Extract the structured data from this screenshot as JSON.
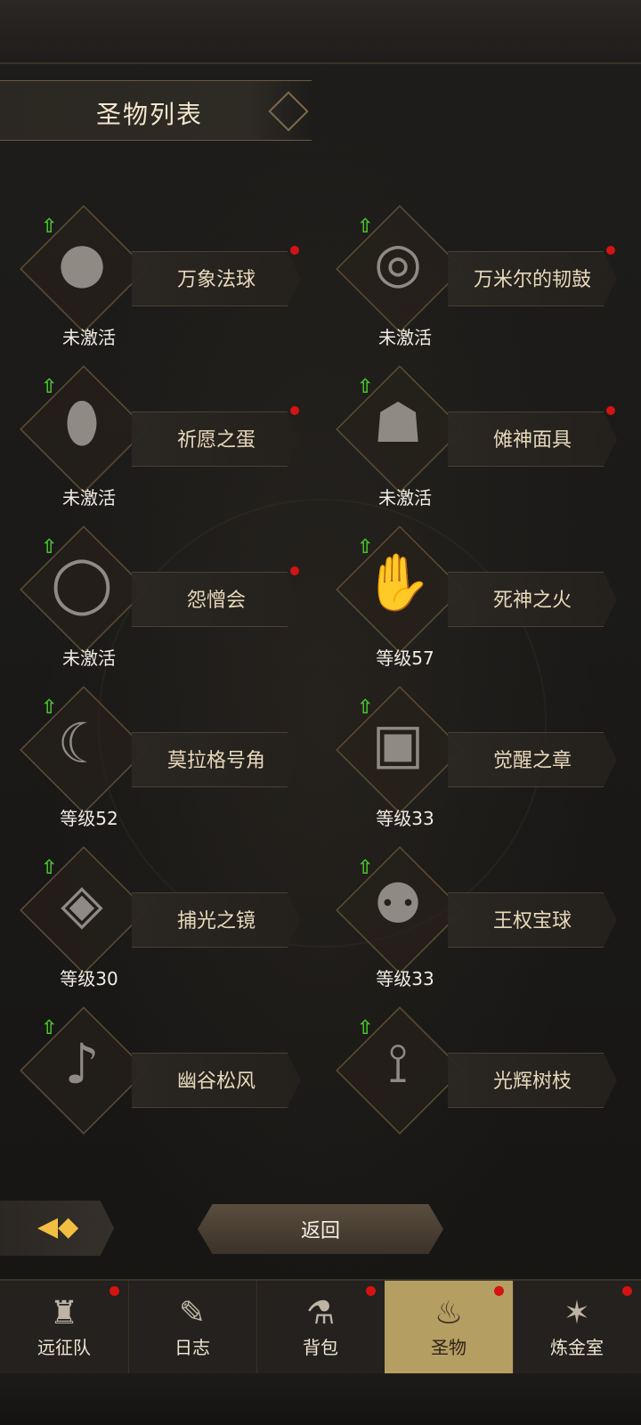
{
  "header": {
    "title": "圣物列表"
  },
  "items": [
    {
      "name": "万象法球",
      "status": "未激活",
      "icon": "●",
      "has_dot": true
    },
    {
      "name": "万米尔的韧鼓",
      "status": "未激活",
      "icon": "◎",
      "has_dot": true
    },
    {
      "name": "祈愿之蛋",
      "status": "未激活",
      "icon": "⬮",
      "has_dot": true
    },
    {
      "name": "傩神面具",
      "status": "未激活",
      "icon": "☗",
      "has_dot": true
    },
    {
      "name": "怨憎会",
      "status": "未激活",
      "icon": "◯",
      "has_dot": true
    },
    {
      "name": "死神之火",
      "status": "等级57",
      "icon": "✋",
      "has_dot": false
    },
    {
      "name": "莫拉格号角",
      "status": "等级52",
      "icon": "☾",
      "has_dot": false
    },
    {
      "name": "觉醒之章",
      "status": "等级33",
      "icon": "▣",
      "has_dot": false
    },
    {
      "name": "捕光之镜",
      "status": "等级30",
      "icon": "◈",
      "has_dot": false
    },
    {
      "name": "王权宝球",
      "status": "等级33",
      "icon": "⚉",
      "has_dot": false
    },
    {
      "name": "幽谷松风",
      "status": "",
      "icon": "♪",
      "has_dot": false
    },
    {
      "name": "光辉树枝",
      "status": "",
      "icon": "⟟",
      "has_dot": false
    }
  ],
  "buttons": {
    "return_label": "返回"
  },
  "nav": {
    "tabs": [
      {
        "label": "远征队",
        "icon": "♜",
        "badge": true
      },
      {
        "label": "日志",
        "icon": "✎",
        "badge": false
      },
      {
        "label": "背包",
        "icon": "⚗",
        "badge": true
      },
      {
        "label": "圣物",
        "icon": "♨",
        "badge": true,
        "active": true
      },
      {
        "label": "炼金室",
        "icon": "✶",
        "badge": true
      }
    ]
  },
  "colors": {
    "accent": "#b59e62",
    "badge": "#d41313",
    "upgrade": "#48c12b"
  }
}
